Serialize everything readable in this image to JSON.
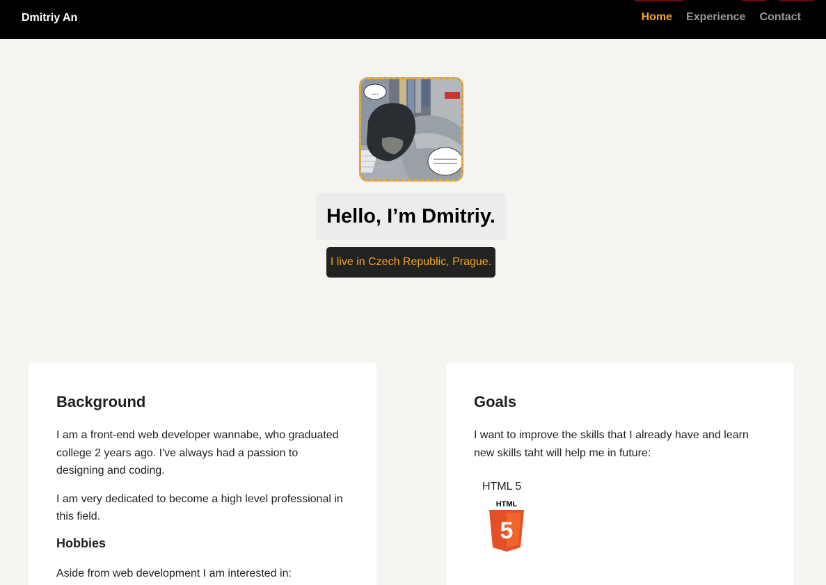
{
  "nav": {
    "brand": "Dmitriy An",
    "links": [
      "Home",
      "Experience",
      "Contact"
    ],
    "active": "Home",
    "colors": {
      "background": "#000000",
      "active": "#f5a623",
      "inactive": "#9a9a9a"
    }
  },
  "hero": {
    "avatar_icon": "manga-avatar-image",
    "bubble_top": "...",
    "greeting": "Hello, I’m Dmitriy.",
    "location": "I live in Czech Republic, Prague."
  },
  "background": {
    "title": "Background",
    "paragraphs": [
      "I am a front-end web developer wannabe, who graduated college 2 years ago. I've always had a passion to designing and coding.",
      "I am very dedicated to become a high level professional in this field."
    ],
    "hobbies_title": "Hobbies",
    "hobbies_intro": "Aside from web development I am interested in:"
  },
  "goals": {
    "title": "Goals",
    "intro": "I want to improve the skills that I already have and learn new skills taht will help me in future:",
    "skills": [
      {
        "label": "HTML 5",
        "icon": "html5-icon",
        "logo_text": "HTML",
        "logo_number": "5"
      }
    ]
  },
  "colors": {
    "page_bg": "#f5f4f0",
    "accent": "#f5a623",
    "card_bg": "#ffffff"
  }
}
